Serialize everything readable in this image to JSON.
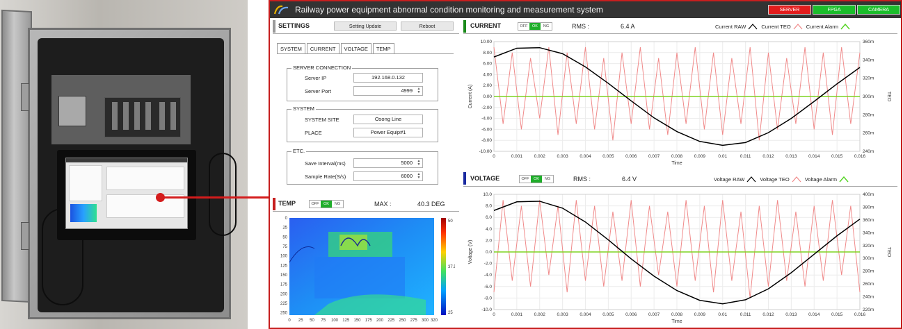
{
  "app": {
    "title": "Railway power equipment abnormal condition monitoring and measurement system",
    "status_buttons": [
      {
        "label": "SERVER",
        "color": "#e31b1b"
      },
      {
        "label": "FPGA",
        "color": "#1bbd2b"
      },
      {
        "label": "CAMERA",
        "color": "#1bbd2b"
      }
    ]
  },
  "settings": {
    "title": "SETTINGS",
    "update_label": "Setting Update",
    "reboot_label": "Reboot",
    "tabs": [
      "SYSTEM",
      "CURRENT",
      "VOLTAGE",
      "TEMP"
    ],
    "server_connection": {
      "group_label": "SERVER CONNECTION",
      "ip_label": "Server IP",
      "ip_value": "192.168.0.132",
      "port_label": "Server Port",
      "port_value": "4999"
    },
    "system": {
      "group_label": "SYSTEM",
      "site_label": "SYSTEM SITE",
      "site_value": "Osong Line",
      "place_label": "PLACE",
      "place_value": "Power Equip#1"
    },
    "etc": {
      "group_label": "ETC.",
      "interval_label": "Save Interval(ms)",
      "interval_value": "5000",
      "rate_label": "Sample Rate(S/s)",
      "rate_value": "6000"
    }
  },
  "temp": {
    "title": "TEMP",
    "toggle": [
      "OFF",
      "OK",
      "NG"
    ],
    "toggle_active": "OK",
    "max_label": "MAX :",
    "max_value": "40.3 DEG",
    "x_ticks": [
      "0",
      "25",
      "50",
      "75",
      "100",
      "125",
      "150",
      "175",
      "200",
      "225",
      "250",
      "275",
      "300",
      "320"
    ],
    "y_ticks": [
      "0",
      "25",
      "50",
      "75",
      "100",
      "125",
      "150",
      "175",
      "200",
      "225",
      "250"
    ],
    "colorbar_ticks": [
      "50",
      "37.5",
      "25"
    ],
    "colors": {
      "bar_accent": "#c61e1e"
    }
  },
  "current": {
    "title": "CURRENT",
    "toggle": [
      "OFF",
      "OK",
      "NG"
    ],
    "toggle_active": "OK",
    "rms_label": "RMS :",
    "rms_value": "6.4 A",
    "legend": [
      "Current RAW",
      "Current TEO",
      "Current Alarm"
    ],
    "bar_color": "#1a8a1a"
  },
  "voltage": {
    "title": "VOLTAGE",
    "toggle": [
      "OFF",
      "OK",
      "NG"
    ],
    "toggle_active": "OK",
    "rms_label": "RMS :",
    "rms_value": "6.4 V",
    "legend": [
      "Voltage RAW",
      "Voltage TEO",
      "Voltage Alarm"
    ],
    "bar_color": "#1a2aa0"
  },
  "chart_data": [
    {
      "type": "line",
      "title": "CURRENT",
      "xlabel": "Time",
      "ylabel": "Current (A)",
      "y2label": "TEO",
      "xlim": [
        0,
        0.016
      ],
      "ylim": [
        -10,
        10
      ],
      "y2lim": [
        "240m",
        "360m"
      ],
      "x_ticks": [
        "0",
        "0.001",
        "0.002",
        "0.003",
        "0.004",
        "0.005",
        "0.006",
        "0.007",
        "0.008",
        "0.009",
        "0.01",
        "0.011",
        "0.012",
        "0.013",
        "0.014",
        "0.015",
        "0.016"
      ],
      "y_ticks": [
        "10.00",
        "8.00",
        "6.00",
        "4.00",
        "2.00",
        "0.00",
        "-2.00",
        "-4.00",
        "-6.00",
        "-8.00",
        "-10.00"
      ],
      "y2_ticks": [
        "360m",
        "340m",
        "320m",
        "300m",
        "280m",
        "260m",
        "240m"
      ],
      "series": [
        {
          "name": "Current RAW",
          "color": "#000000",
          "x": [
            0,
            0.001,
            0.002,
            0.003,
            0.004,
            0.005,
            0.006,
            0.007,
            0.008,
            0.009,
            0.01,
            0.011,
            0.012,
            0.013,
            0.014,
            0.015,
            0.016
          ],
          "values": [
            7.2,
            8.8,
            8.9,
            7.8,
            5.4,
            2.4,
            -0.8,
            -3.9,
            -6.4,
            -8.2,
            -8.9,
            -8.4,
            -6.6,
            -4.0,
            -0.9,
            2.3,
            5.3
          ]
        },
        {
          "name": "Current TEO",
          "color": "#f08a8a",
          "x": [
            0,
            0.0004,
            0.0008,
            0.0012,
            0.0016,
            0.002,
            0.0024,
            0.0028,
            0.0032,
            0.0036,
            0.004,
            0.0044,
            0.0048,
            0.0052,
            0.0056,
            0.006,
            0.0064,
            0.0068,
            0.0072,
            0.0076,
            0.008,
            0.0084,
            0.0088,
            0.0092,
            0.0096,
            0.01,
            0.0104,
            0.0108,
            0.0112,
            0.0116,
            0.012,
            0.0124,
            0.0128,
            0.0132,
            0.0136,
            0.014,
            0.0144,
            0.0148,
            0.0152,
            0.0156,
            0.016
          ],
          "values": [
            9,
            -5,
            8,
            -6,
            7,
            -4,
            9,
            -7,
            8,
            -5,
            9,
            -6,
            7,
            -8,
            8,
            -5,
            9,
            -6,
            7,
            -7,
            8,
            -5,
            9,
            -6,
            8,
            -7,
            7,
            -5,
            9,
            -8,
            8,
            -6,
            7,
            -5,
            9,
            -6,
            8,
            -7,
            9,
            -5,
            8
          ]
        },
        {
          "name": "Current Alarm",
          "color": "#7ed321",
          "x": [
            0,
            0.016
          ],
          "values": [
            0,
            0
          ]
        }
      ]
    },
    {
      "type": "line",
      "title": "VOLTAGE",
      "xlabel": "Time",
      "ylabel": "Voltage (V)",
      "y2label": "TEO",
      "xlim": [
        0,
        0.016
      ],
      "ylim": [
        -10,
        10
      ],
      "y2lim": [
        "220m",
        "400m"
      ],
      "x_ticks": [
        "0",
        "0.001",
        "0.002",
        "0.003",
        "0.004",
        "0.005",
        "0.006",
        "0.007",
        "0.008",
        "0.009",
        "0.01",
        "0.011",
        "0.012",
        "0.013",
        "0.014",
        "0.015",
        "0.016"
      ],
      "y_ticks": [
        "10.0",
        "8.0",
        "6.0",
        "4.0",
        "2.0",
        "0.0",
        "-2.0",
        "-4.0",
        "-6.0",
        "-8.0",
        "-10.0"
      ],
      "y2_ticks": [
        "400m",
        "380m",
        "360m",
        "340m",
        "320m",
        "300m",
        "280m",
        "260m",
        "240m",
        "220m"
      ],
      "series": [
        {
          "name": "Voltage RAW",
          "color": "#000000",
          "x": [
            0,
            0.001,
            0.002,
            0.003,
            0.004,
            0.005,
            0.006,
            0.007,
            0.008,
            0.009,
            0.01,
            0.011,
            0.012,
            0.013,
            0.014,
            0.015,
            0.016
          ],
          "values": [
            7.2,
            8.7,
            8.8,
            7.6,
            5.2,
            2.1,
            -1.2,
            -4.2,
            -6.7,
            -8.4,
            -9.0,
            -8.3,
            -6.4,
            -3.6,
            -0.4,
            2.8,
            5.7
          ]
        },
        {
          "name": "Voltage TEO",
          "color": "#f08a8a",
          "x": [
            0,
            0.0004,
            0.0008,
            0.0012,
            0.0016,
            0.002,
            0.0024,
            0.0028,
            0.0032,
            0.0036,
            0.004,
            0.0044,
            0.0048,
            0.0052,
            0.0056,
            0.006,
            0.0064,
            0.0068,
            0.0072,
            0.0076,
            0.008,
            0.0084,
            0.0088,
            0.0092,
            0.0096,
            0.01,
            0.0104,
            0.0108,
            0.0112,
            0.0116,
            0.012,
            0.0124,
            0.0128,
            0.0132,
            0.0136,
            0.014,
            0.0144,
            0.0148,
            0.0152,
            0.0156,
            0.016
          ],
          "values": [
            -7,
            9,
            -5,
            8,
            -6,
            9,
            -4,
            8,
            -7,
            9,
            -5,
            8,
            -6,
            7,
            -5,
            9,
            -6,
            8,
            -4,
            7,
            -6,
            9,
            -5,
            8,
            -7,
            9,
            -5,
            7,
            -8,
            8,
            -6,
            9,
            -5,
            7,
            -6,
            8,
            -5,
            9,
            -4,
            8,
            -7
          ]
        },
        {
          "name": "Voltage Alarm",
          "color": "#7ed321",
          "x": [
            0,
            0.016
          ],
          "values": [
            0,
            0
          ]
        }
      ]
    }
  ]
}
